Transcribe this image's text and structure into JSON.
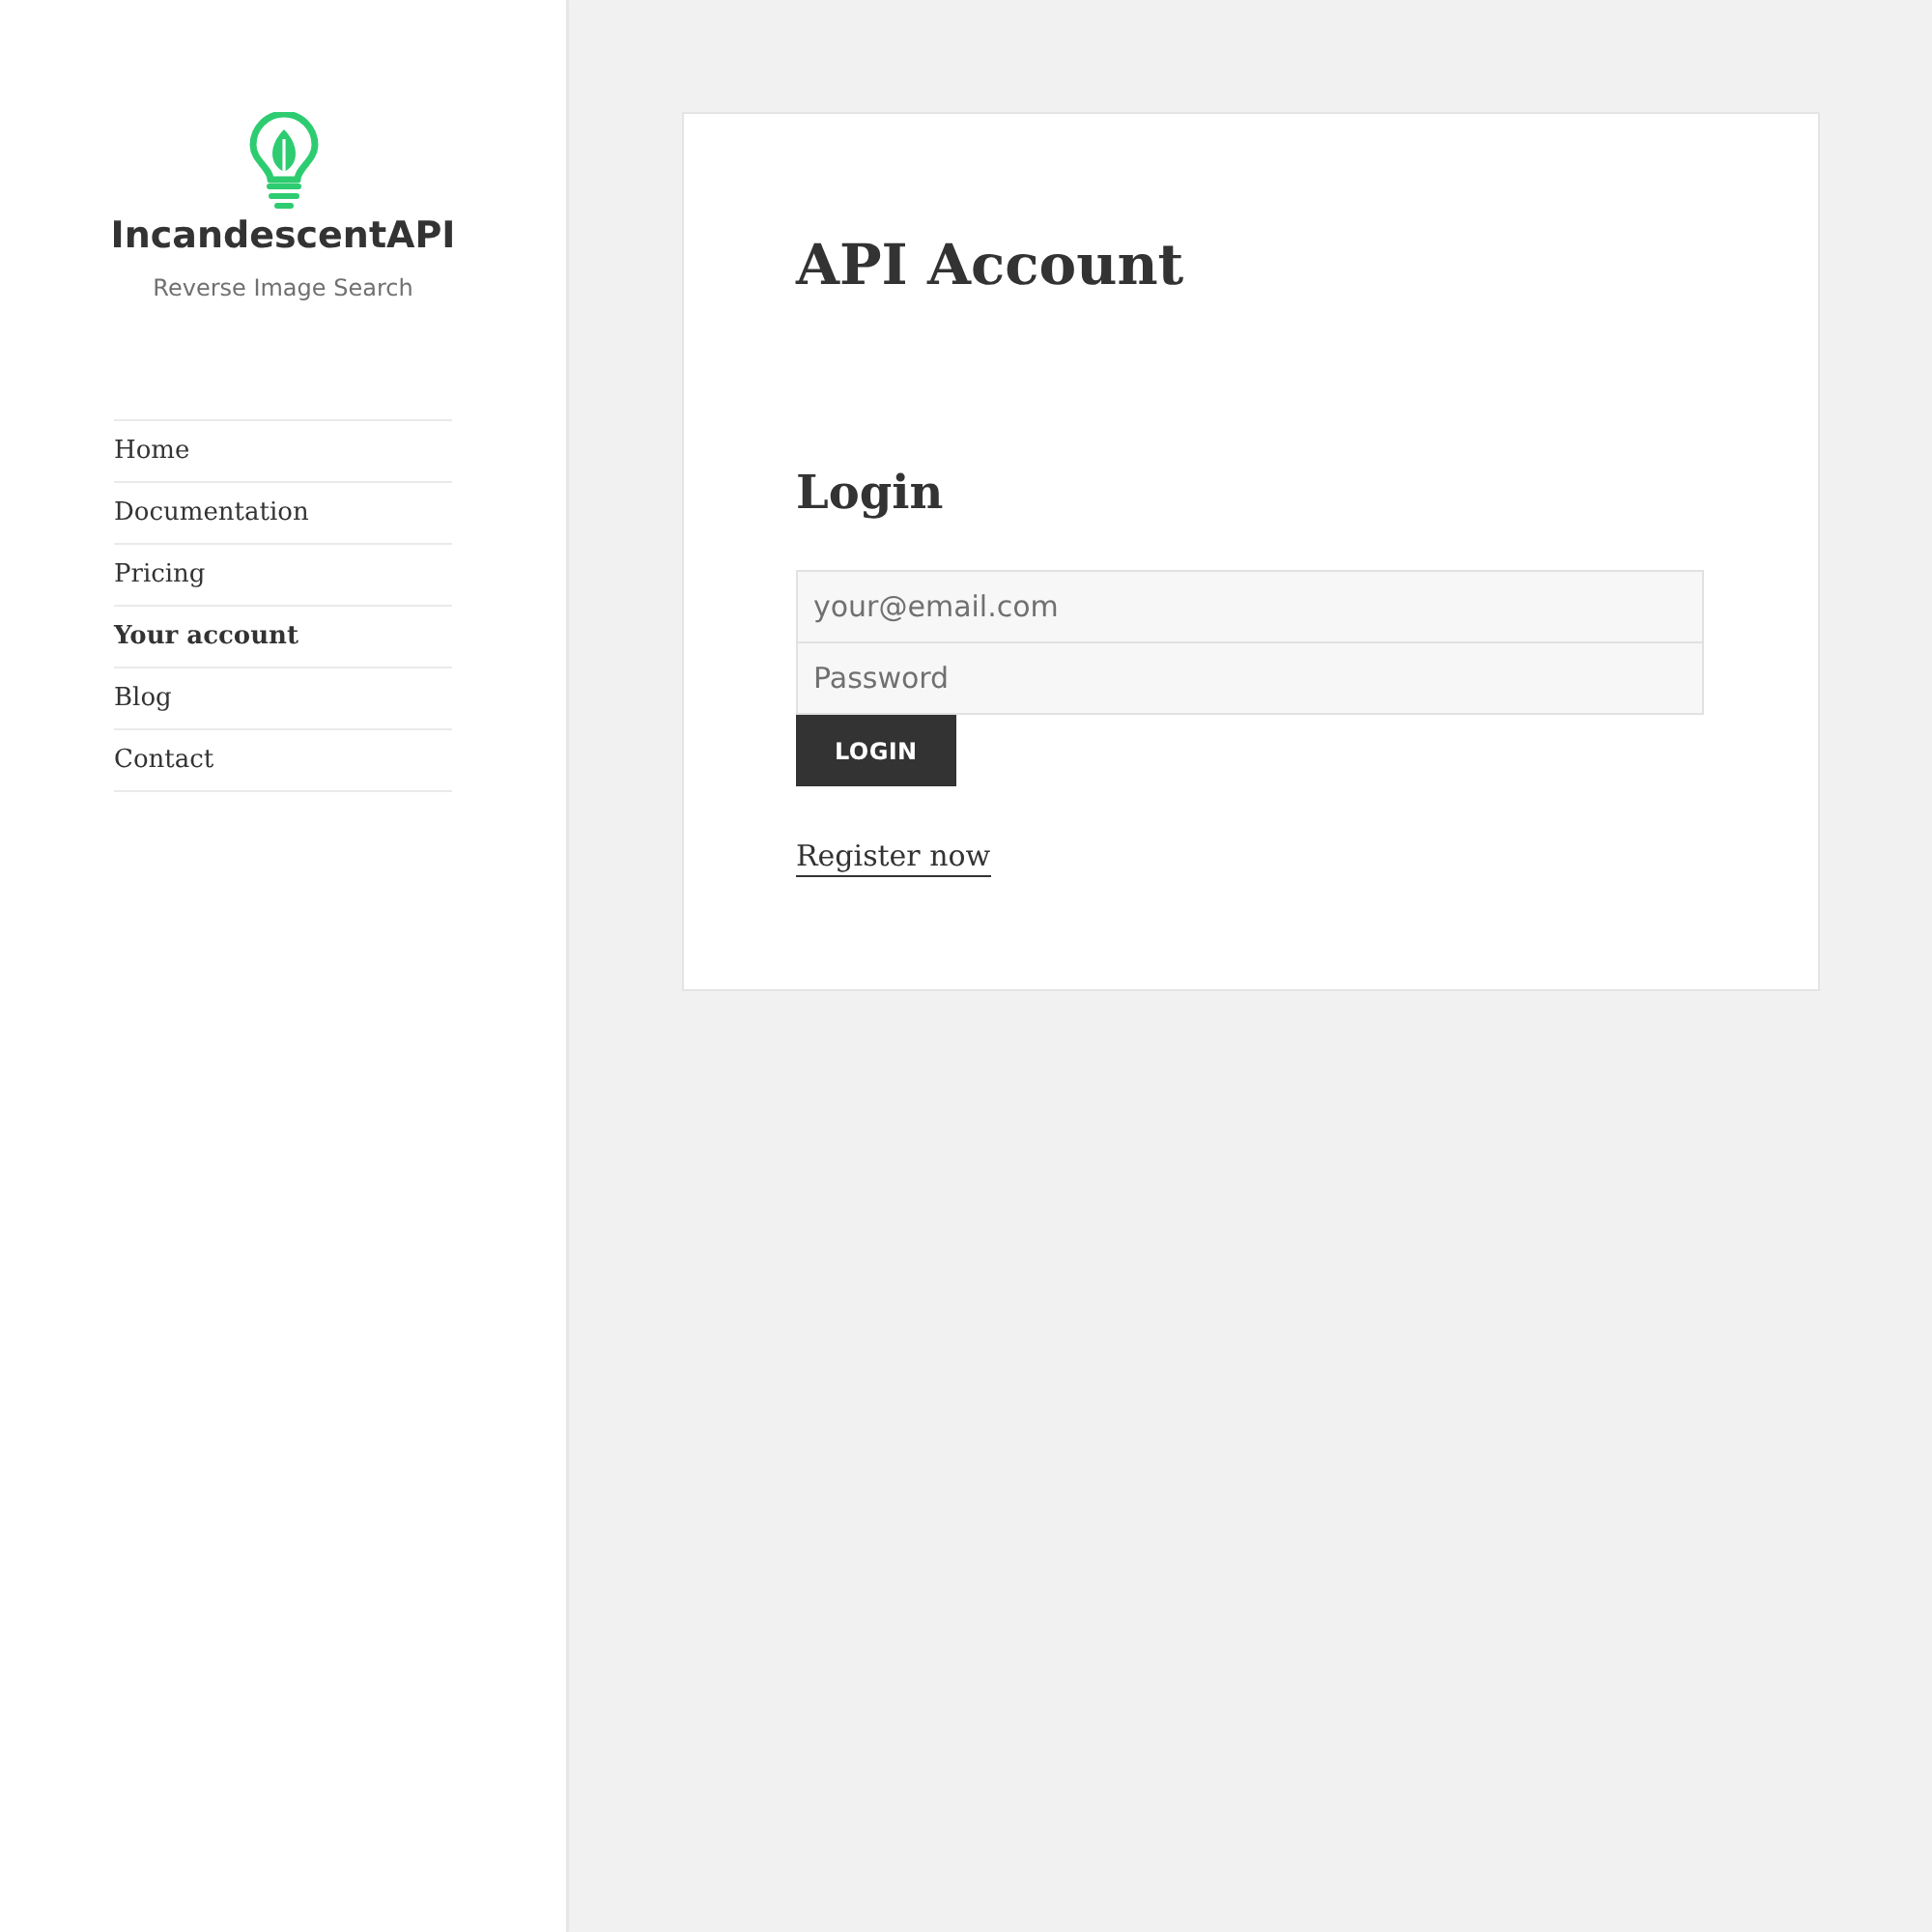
{
  "site": {
    "title": "IncandescentAPI",
    "tagline": "Reverse Image Search"
  },
  "nav": [
    {
      "label": "Home",
      "selected": false
    },
    {
      "label": "Documentation",
      "selected": false
    },
    {
      "label": "Pricing",
      "selected": false
    },
    {
      "label": "Your account",
      "selected": true
    },
    {
      "label": "Blog",
      "selected": false
    },
    {
      "label": "Contact",
      "selected": false
    }
  ],
  "page": {
    "title": "API Account",
    "section_title": "Login",
    "fields": [
      {
        "placeholder": "your@email.com"
      },
      {
        "placeholder": "Password"
      }
    ],
    "button": "LOGIN",
    "link": "Register now"
  }
}
